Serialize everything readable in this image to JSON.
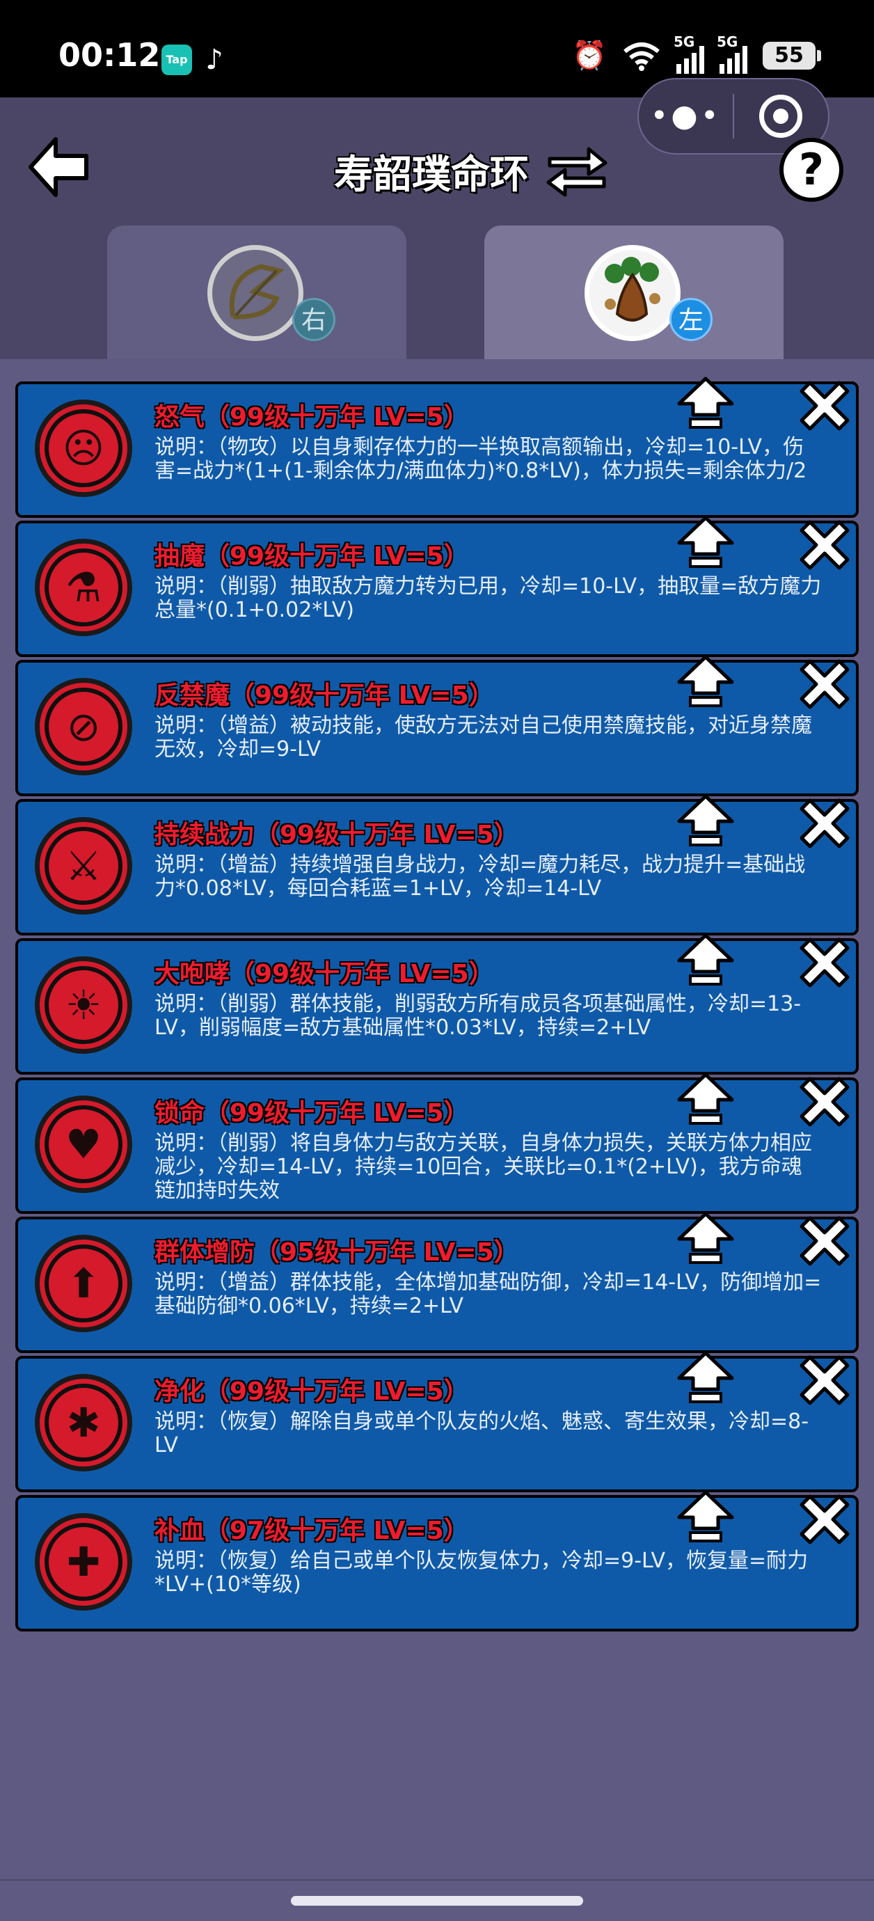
{
  "status_bar": {
    "time": "00:12",
    "tap_label": "Tap",
    "signal1_label": "5G",
    "signal2_label": "5G",
    "battery": "55"
  },
  "header": {
    "title": "寿韶璞命环",
    "help_label": "?"
  },
  "tabs": [
    {
      "badge": "右",
      "avatar": "bow-icon"
    },
    {
      "badge": "左",
      "avatar": "root-plant-icon"
    }
  ],
  "skills": [
    {
      "title": "怒气（99级十万年 LV=5）",
      "desc": "说明：（物攻）以自身剩存体力的一半换取高额输出，冷却=10-LV，伤害=战力*(1+(1-剩余体力/满血体力)*0.8*LV)，体力损失=剩余体力/2",
      "icon": "angry-face-icon"
    },
    {
      "title": "抽魔（99级十万年 LV=5）",
      "desc": "说明：（削弱）抽取敌方魔力转为已用，冷却=10-LV，抽取量=敌方魔力总量*(0.1+0.02*LV)",
      "icon": "syringe-icon"
    },
    {
      "title": "反禁魔（99级十万年 LV=5）",
      "desc": "说明：（增益）被动技能，使敌方无法对自己使用禁魔技能，对近身禁魔无效，冷却=9-LV",
      "icon": "no-magic-icon"
    },
    {
      "title": "持续战力（99级十万年 LV=5）",
      "desc": "说明：（增益）持续增强自身战力，冷却=魔力耗尽，战力提升=基础战力*0.08*LV，每回合耗蓝=1+LV，冷却=14-LV",
      "icon": "sword-cycle-icon"
    },
    {
      "title": "大咆哮（99级十万年 LV=5）",
      "desc": "说明：（削弱）群体技能，削弱敌方所有成员各项基础属性，冷却=13-LV，削弱幅度=敌方基础属性*0.03*LV，持续=2+LV",
      "icon": "roaring-lion-icon"
    },
    {
      "title": "锁命（99级十万年 LV=5）",
      "desc": "说明：（削弱）将自身体力与敌方关联，自身体力损失，关联方体力相应减少，冷却=14-LV，持续=10回合，关联比=0.1*(2+LV)，我方命魂链加持时失效",
      "icon": "locked-heart-icon"
    },
    {
      "title": "群体增防（95级十万年 LV=5）",
      "desc": "说明：（增益）群体技能，全体增加基础防御，冷却=14-LV，防御增加=基础防御*0.06*LV，持续=2+LV",
      "icon": "shield-up-icon"
    },
    {
      "title": "净化（99级十万年 LV=5）",
      "desc": "说明：（恢复）解除自身或单个队友的火焰、魅惑、寄生效果，冷却=8-LV",
      "icon": "purify-icon"
    },
    {
      "title": "补血（97级十万年 LV=5）",
      "desc": "说明：（恢复）给自己或单个队友恢复体力，冷却=9-LV，恢复量=耐力*LV+(10*等级)",
      "icon": "heal-heart-icon"
    }
  ]
}
